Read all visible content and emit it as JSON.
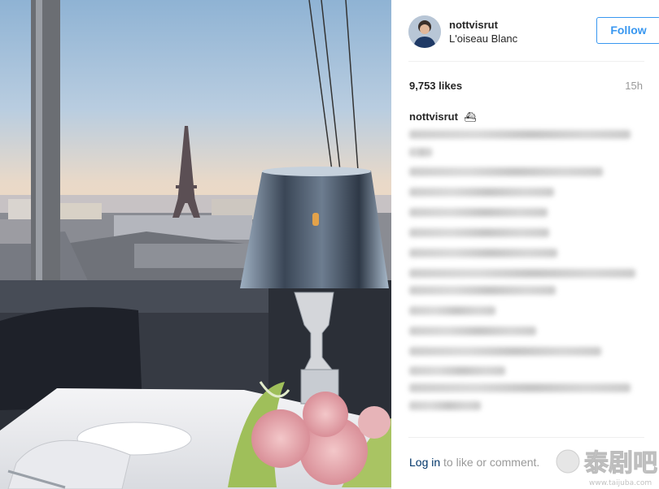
{
  "post": {
    "username": "nottvisrut",
    "location": "L'oiseau Blanc",
    "follow_label": "Follow",
    "likes": "9,753 likes",
    "time_ago": "15h",
    "caption_user": "nottvisrut",
    "caption_emoji": "⛴"
  },
  "footer": {
    "login_label": "Log in",
    "login_suffix": " to like or comment."
  },
  "watermark": {
    "text": "泰剧吧",
    "url": "www.taijuba.com"
  },
  "colors": {
    "accent": "#3897f0",
    "link": "#003569",
    "muted": "#999999"
  },
  "icons": {
    "avatar": "profile-photo",
    "photo": "eiffel-tower-restaurant-view"
  }
}
